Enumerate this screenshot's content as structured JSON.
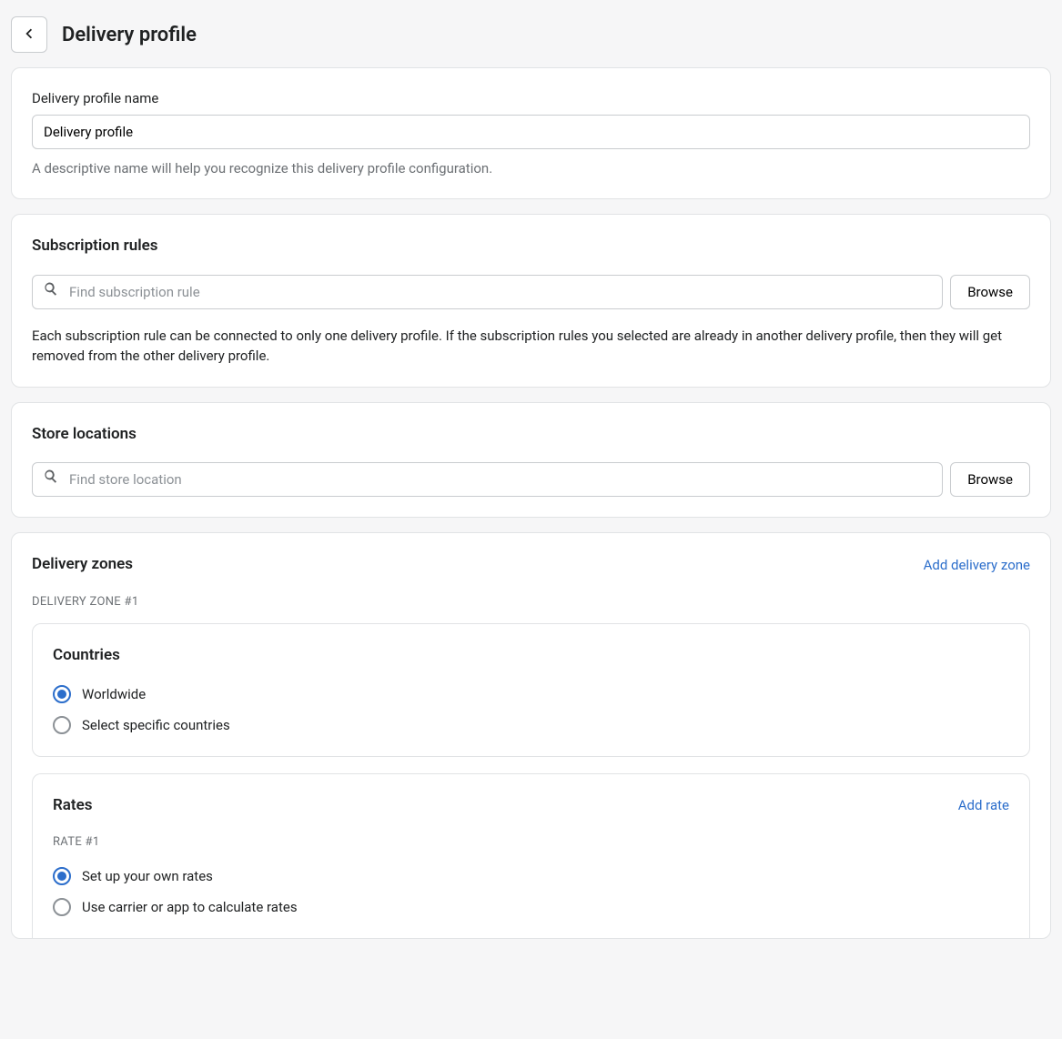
{
  "header": {
    "title": "Delivery profile"
  },
  "name_section": {
    "label": "Delivery profile name",
    "value": "Delivery profile",
    "helper": "A descriptive name will help you recognize this delivery profile configuration."
  },
  "subscription_section": {
    "title": "Subscription rules",
    "search_placeholder": "Find subscription rule",
    "browse_label": "Browse",
    "note": "Each subscription rule can be connected to only one delivery profile. If the subscription rules you selected are already in another delivery profile, then they will get removed from the other delivery profile."
  },
  "locations_section": {
    "title": "Store locations",
    "search_placeholder": "Find store location",
    "browse_label": "Browse"
  },
  "zones_section": {
    "title": "Delivery zones",
    "add_label": "Add delivery zone",
    "zones": [
      {
        "heading": "DELIVERY ZONE #1",
        "countries": {
          "title": "Countries",
          "options": [
            {
              "label": "Worldwide",
              "checked": true
            },
            {
              "label": "Select specific countries",
              "checked": false
            }
          ]
        },
        "rates": {
          "title": "Rates",
          "add_label": "Add rate",
          "items": [
            {
              "heading": "RATE #1",
              "options": [
                {
                  "label": "Set up your own rates",
                  "checked": true
                },
                {
                  "label": "Use carrier or app to calculate rates",
                  "checked": false
                }
              ]
            }
          ]
        }
      }
    ]
  }
}
